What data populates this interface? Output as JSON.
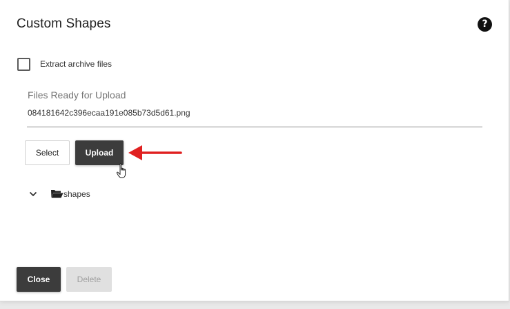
{
  "dialog": {
    "title": "Custom Shapes",
    "help_icon": "question-circle-icon",
    "extract": {
      "label": "Extract archive files",
      "checked": false
    },
    "files_field": {
      "label": "Files Ready for Upload",
      "value": "084181642c396ecaa191e085b73d5d61.png"
    },
    "buttons": {
      "select": "Select",
      "upload": "Upload",
      "close": "Close",
      "delete": "Delete"
    },
    "tree": {
      "toggle_icon": "chevron-down-icon",
      "folder_icon": "folder-open-icon",
      "folder_label": "shapes"
    },
    "annotation": {
      "arrow_color": "#e02020"
    }
  }
}
